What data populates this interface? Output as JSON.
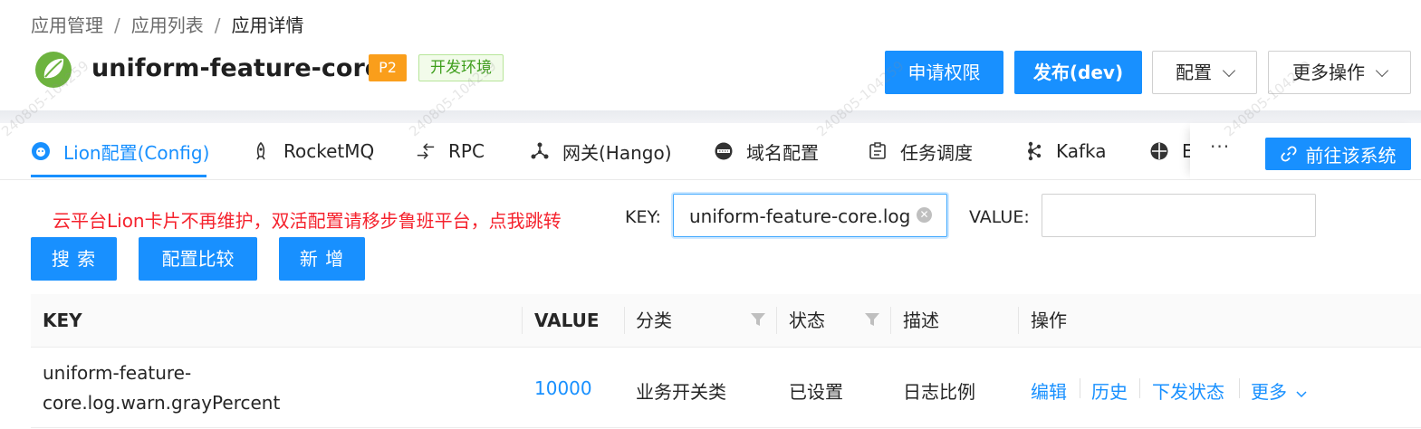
{
  "breadcrumb": {
    "item1": "应用管理",
    "item2": "应用列表",
    "current": "应用详情",
    "separator": "/"
  },
  "app": {
    "name": "uniform-feature-core",
    "priority_tag": "P2",
    "env_tag": "开发环境"
  },
  "header_actions": {
    "apply_permission": "申请权限",
    "publish": "发布(dev)",
    "config": "配置",
    "more_actions": "更多操作"
  },
  "tabs": [
    {
      "label": "Lion配置(Config)",
      "icon": "lion-icon",
      "active": true
    },
    {
      "label": "RocketMQ",
      "icon": "rocket-icon"
    },
    {
      "label": "RPC",
      "icon": "rpc-icon"
    },
    {
      "label": "网关(Hango)",
      "icon": "gateway-icon"
    },
    {
      "label": "域名配置",
      "icon": "domain-icon"
    },
    {
      "label": "任务调度",
      "icon": "task-icon"
    },
    {
      "label": "Kafka",
      "icon": "kafka-icon"
    },
    {
      "label": "E",
      "icon": "e-icon"
    }
  ],
  "tabs_more": "···",
  "goto_system": "前往该系统",
  "notice": "云平台Lion卡片不再维护，双活配置请移步鲁班平台，点我跳转",
  "search": {
    "key_label": "KEY:",
    "key_value": "uniform-feature-core.log.warn.grayPercent",
    "value_label": "VALUE:",
    "value_value": ""
  },
  "buttons": {
    "search": "搜 索",
    "compare": "配置比较",
    "add": "新 增"
  },
  "table": {
    "columns": {
      "key": "KEY",
      "value": "VALUE",
      "category": "分类",
      "status": "状态",
      "desc": "描述",
      "ops": "操作"
    },
    "rows": [
      {
        "key_line1": "uniform-feature-",
        "key_line2": "core.log.warn.grayPercent",
        "value": "10000",
        "category": "业务开关类",
        "status": "已设置",
        "desc": "日志比例",
        "ops": {
          "edit": "编辑",
          "history": "历史",
          "dispatch_status": "下发状态",
          "more": "更多"
        }
      }
    ]
  },
  "watermark": "240805-104259"
}
